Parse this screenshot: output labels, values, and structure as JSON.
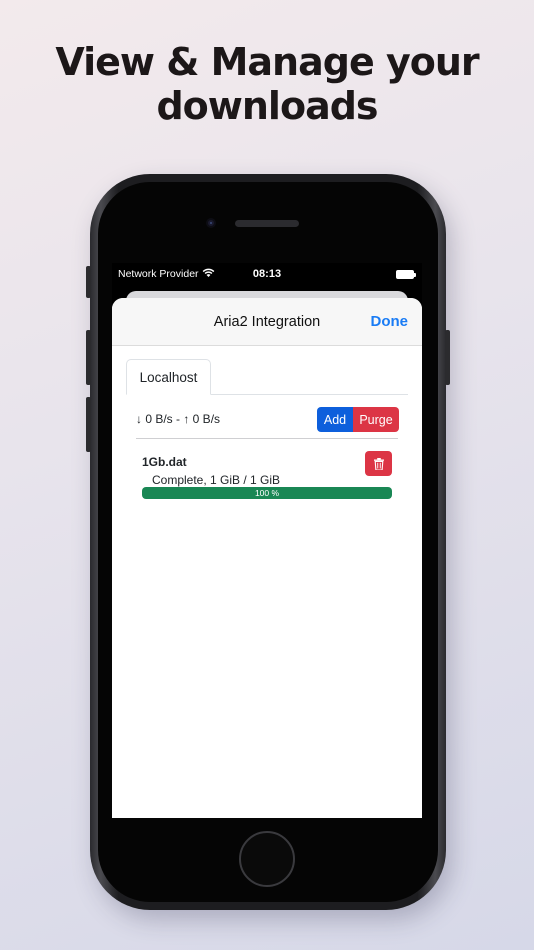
{
  "headline": {
    "line1": "View & Manage your",
    "line2": "downloads"
  },
  "status_bar": {
    "carrier": "Network Provider",
    "time": "08:13"
  },
  "nav": {
    "title": "Aria2 Integration",
    "done_label": "Done"
  },
  "tabs": [
    {
      "label": "Localhost",
      "active": true
    }
  ],
  "toolbar": {
    "speed_text": "↓ 0 B/s - ↑ 0 B/s",
    "add_label": "Add",
    "purge_label": "Purge"
  },
  "downloads": [
    {
      "name": "1Gb.dat",
      "status": "Complete, 1 GiB / 1 GiB",
      "progress_label": "100 %",
      "progress_fraction": 1.0
    }
  ],
  "colors": {
    "accent": "#1a7cf5",
    "primary_button": "#0d5fdc",
    "danger": "#dc3545",
    "success": "#198754"
  },
  "icons": [
    "wifi-icon",
    "battery-icon",
    "trash-icon"
  ]
}
